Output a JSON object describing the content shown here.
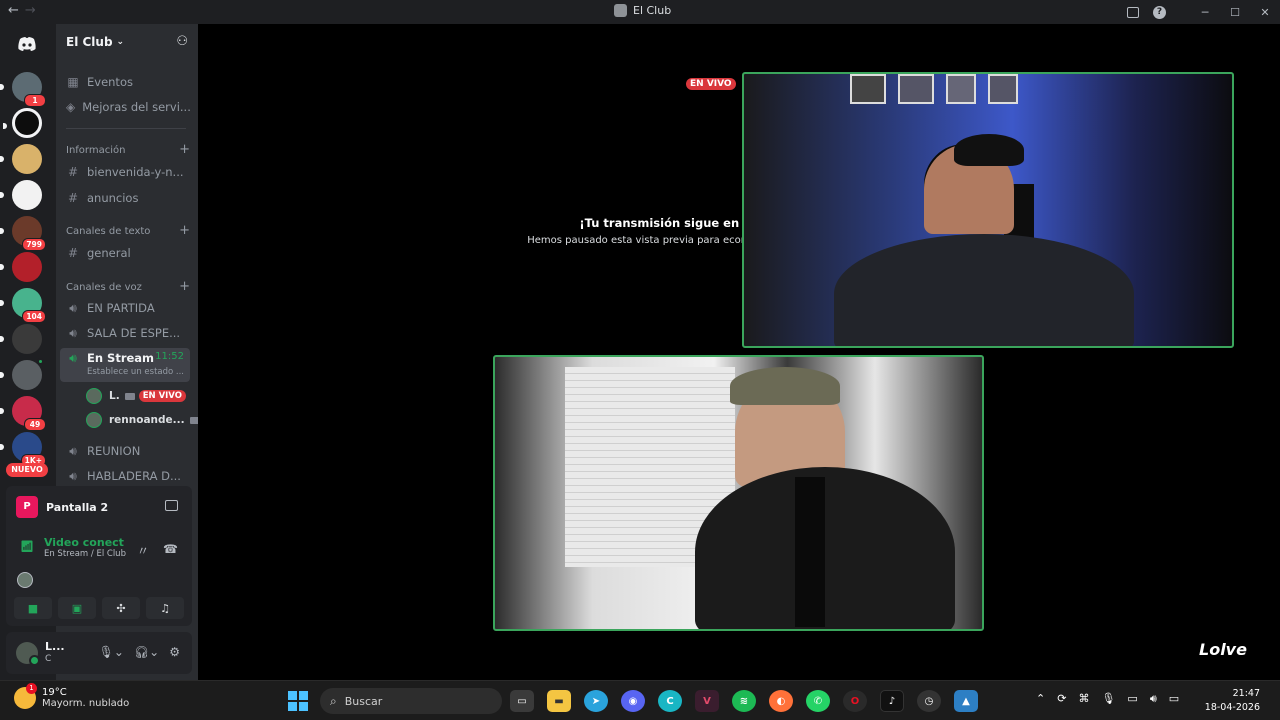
{
  "window": {
    "title": "El Club",
    "back": "←",
    "forward": "→",
    "minimize": "─",
    "maximize": "☐",
    "close": "✕",
    "help": "?"
  },
  "servers": [
    {
      "badge": "1",
      "color": "#5c6b73"
    },
    {
      "badge": "",
      "color": "#0d0d0d"
    },
    {
      "badge": "",
      "color": "#d9b26a"
    },
    {
      "badge": "",
      "color": "#f2f2f2"
    },
    {
      "badge": "799",
      "color": "#6b3a2a"
    },
    {
      "badge": "",
      "color": "#b3202a"
    },
    {
      "badge": "104",
      "color": "#48b38d"
    },
    {
      "badge": "",
      "color": "#3a3a3a"
    },
    {
      "badge": "",
      "color": "#5a5f63"
    },
    {
      "badge": "49",
      "color": "#c82b4a"
    },
    {
      "badge": "1K+",
      "color": "#2a4a8a"
    }
  ],
  "nuevo_label": "NUEVO",
  "guild": {
    "name": "El Club"
  },
  "nav": {
    "events": "Eventos",
    "boosts": "Mejoras del servi..."
  },
  "categories": {
    "info": "Información",
    "text": "Canales de texto",
    "voice": "Canales de voz"
  },
  "info_channels": [
    "bienvenida-y-n...",
    "anuncios"
  ],
  "text_channels": [
    "general"
  ],
  "voice_channels": {
    "partida": "EN PARTIDA",
    "sala": "SALA DE ESPE...",
    "stream": "En Stream",
    "stream_timer": "11:52",
    "stream_status": "Establece un estado ...",
    "reunion": "REUNION",
    "habladera": "HABLADERA D..."
  },
  "voice_users": [
    {
      "name": "L.",
      "live": "EN VIVO"
    },
    {
      "name": "rennoande..."
    }
  ],
  "voice_panel": {
    "screen_name": "Pantalla 2",
    "screen_icon_letter": "P",
    "status": "Video conectado",
    "location": "En Stream / El Club"
  },
  "user": {
    "name": "L...",
    "sub": "C"
  },
  "stage": {
    "paused_title": "¡Tu transmisión sigue en marcha!",
    "paused_text": "Hemos pausado esta vista previa para economizar tus recursos.",
    "live_tag": "EN VIVO",
    "watermark": "Lolve"
  },
  "taskbar": {
    "weather_temp": "19°C",
    "weather_desc": "Mayorm. nublado",
    "weather_badge": "1",
    "search_placeholder": "Buscar",
    "time": "21:47",
    "date": "18-04-2026"
  }
}
